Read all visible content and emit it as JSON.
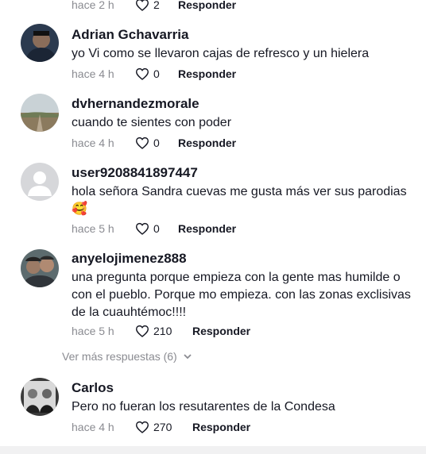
{
  "labels": {
    "reply": "Responder"
  },
  "top_partial": {
    "time": "hace 2 h",
    "likes": "2"
  },
  "comments": [
    {
      "username": "Adrian Gchavarria",
      "text": "yo Vi como se llevaron cajas de refresco y un hielera",
      "time": "hace 4 h",
      "likes": "0"
    },
    {
      "username": "dvhernandezmorale",
      "text": "cuando te sientes con poder",
      "time": "hace 4 h",
      "likes": "0"
    },
    {
      "username": "user9208841897447",
      "text": "hola señora Sandra cuevas me gusta más ver sus parodias 🥰",
      "time": "hace 5 h",
      "likes": "0"
    },
    {
      "username": "anyelojimenez888",
      "text": "una pregunta porque empieza con la gente mas humilde o con el pueblo. Porque mo empieza. con las zonas exclisivas de la cuauhtémoc!!!!",
      "time": "hace 5 h",
      "likes": "210"
    },
    {
      "username": "Carlos",
      "text": "Pero no fueran los resutarentes de la Condesa",
      "time": "hace 4 h",
      "likes": "270"
    }
  ],
  "view_more": "Ver más respuestas (6)",
  "colors": {
    "text": "#161823",
    "muted": "#8a8b91"
  },
  "icons": {
    "like": "heart-outline-icon",
    "expand": "chevron-down-icon"
  }
}
